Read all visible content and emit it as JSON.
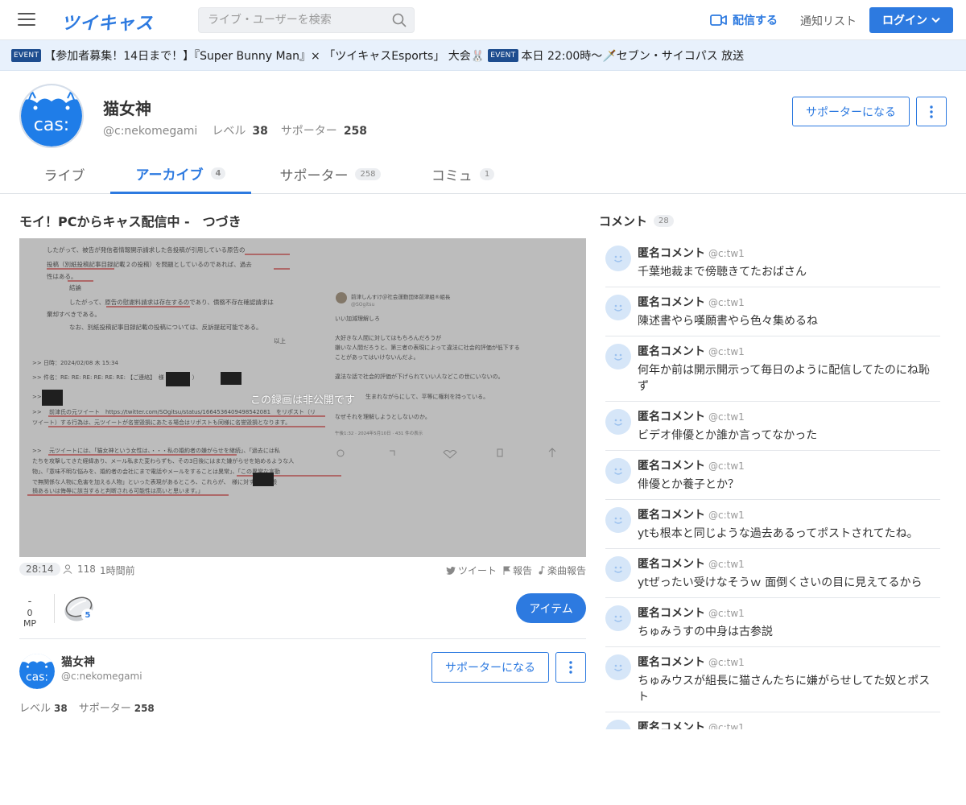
{
  "header": {
    "logo": "ツイキャス",
    "search_placeholder": "ライブ・ユーザーを検索",
    "broadcast_label": "配信する",
    "notif_label": "通知リスト",
    "login_label": "ログイン",
    "accent": "#2d7ae0"
  },
  "eventbar": {
    "items": [
      {
        "badge": "EVENT",
        "text": "【参加者募集！14日まで！】『Super Bunny Man』× 「ツイキャスEsports」 大会🐰"
      },
      {
        "badge": "EVENT",
        "text": "本日 22:00時〜🗡️セブン・サイコパス 放送"
      }
    ]
  },
  "profile": {
    "name": "猫女神",
    "id": "@c:nekomegami",
    "level_label": "レベル",
    "level": "38",
    "supporter_label": "サポーター",
    "supporter": "258",
    "support_button": "サポーターになる",
    "avatar_text": "cas:"
  },
  "tabs": [
    {
      "label": "ライブ",
      "count": ""
    },
    {
      "label": "アーカイブ",
      "count": "4"
    },
    {
      "label": "サポーター",
      "count": "258"
    },
    {
      "label": "コミュ",
      "count": "1"
    }
  ],
  "movie": {
    "title": "モイ！PCからキャス配信中 -　つづき",
    "private_message": "この録画は非公開です",
    "duration": "28:14",
    "viewers": "118",
    "ago": "1時間前",
    "tweet_label": "ツイート",
    "report_label": "報告",
    "music_report_label": "楽曲報告",
    "mp_value": "-",
    "mp_label": "0 MP",
    "item_count": "5",
    "item_button": "アイテム"
  },
  "video_doc": {
    "lines": [
      "したがって、被告が発信者情報開示請求した各投稿が引用している原告の",
      "投稿（別紙投稿記事目録記載２の投稿）を問題としているのであれば、過去",
      "性はある。",
      "結論",
      "したがって、原告の慰謝料請求は存在するのであり、債務不存在確認請求は",
      "棄却すべきである。",
      "なお、別紙投稿記事目録記載の投稿については、反訴提起可能である。",
      "以上",
      ">> 日時：2024/02/08 木 15:34",
      ">> 件名：RE: RE: RE: RE: RE: RE: 【ご連絡】　様（弁護士　）",
      ">> 　様",
      ">> 　前津氏の元ツイート　https://twitter.com/SOgitsu/status/1664536409498542081　をリポスト（リ",
      "ツイート）する行為は、元ツイートが名誉毀損にあたる場合はリポストも同様に名誉毀損となります。",
      ">> 　元ツイートには、「猫女神という女性は、・・・私の婚約者の嫌がらせを継続」、「過去には私",
      "たちを攻撃してきた経緯あり、メール私また変わらずも、その3日後にはまた嫌がらせを始めるような人",
      "物」、「意味不明な悩みを、婚約者の会社にまで電話やメールをすることは異常」、「この異常な言動",
      "で無関係な人物に危害を加える人物」といった表現があるところ、これらが、　様に対する名誉毀",
      "損あるいは侮辱に該当すると判断される可能性は高いと思います。」"
    ],
    "tweet_author": "前津しんすけ＠社会運動団体前津組®組長",
    "tweet_handle": "@SOgitsu",
    "tweet_lines": [
      "いい加減理解しろ",
      "大好きな人間に対してはもちろんだろうが",
      "嫌いな人間だろうと、第三者の表現によって違法に社会的評価が低下する",
      "ことがあってはいけないんだよ。",
      "違法な話で社会的評価が下げられていい人などこの世にいないの。",
      "生まれながらにして、平等に権利を持っている。",
      "なぜそれを理解しようとしないのか。"
    ],
    "tweet_time": "午後1:32 · 2024年5月10日 · 431 件の表示"
  },
  "side_profile": {
    "name": "猫女神",
    "id": "@c:nekomegami",
    "support_button": "サポーターになる",
    "level_label": "レベル",
    "level": "38",
    "supporter_label": "サポーター",
    "supporter": "258"
  },
  "comments": {
    "header": "コメント",
    "count": "28",
    "items": [
      {
        "name": "匿名コメント",
        "id": "@c:tw1",
        "text": "千葉地裁まで傍聴きてたおばさん"
      },
      {
        "name": "匿名コメント",
        "id": "@c:tw1",
        "text": "陳述書やら嘆願書やら色々集めるね"
      },
      {
        "name": "匿名コメント",
        "id": "@c:tw1",
        "text": "何年か前は開示開示って毎日のように配信してたのにね恥ず"
      },
      {
        "name": "匿名コメント",
        "id": "@c:tw1",
        "text": "ビデオ俳優とか誰か言ってなかった"
      },
      {
        "name": "匿名コメント",
        "id": "@c:tw1",
        "text": "俳優とか養子とか？"
      },
      {
        "name": "匿名コメント",
        "id": "@c:tw1",
        "text": "ytも根本と同じような過去あるってポストされてたね。"
      },
      {
        "name": "匿名コメント",
        "id": "@c:tw1",
        "text": "ytぜったい受けなそうｗ 面倒くさいの目に見えてるから"
      },
      {
        "name": "匿名コメント",
        "id": "@c:tw1",
        "text": "ちゅみうすの中身は古参説"
      },
      {
        "name": "匿名コメント",
        "id": "@c:tw1",
        "text": "ちゅみウスが組長に猫さんたちに嫌がらせしてた奴とポスト"
      },
      {
        "name": "匿名コメント",
        "id": "@c:tw1",
        "text": ""
      }
    ]
  }
}
